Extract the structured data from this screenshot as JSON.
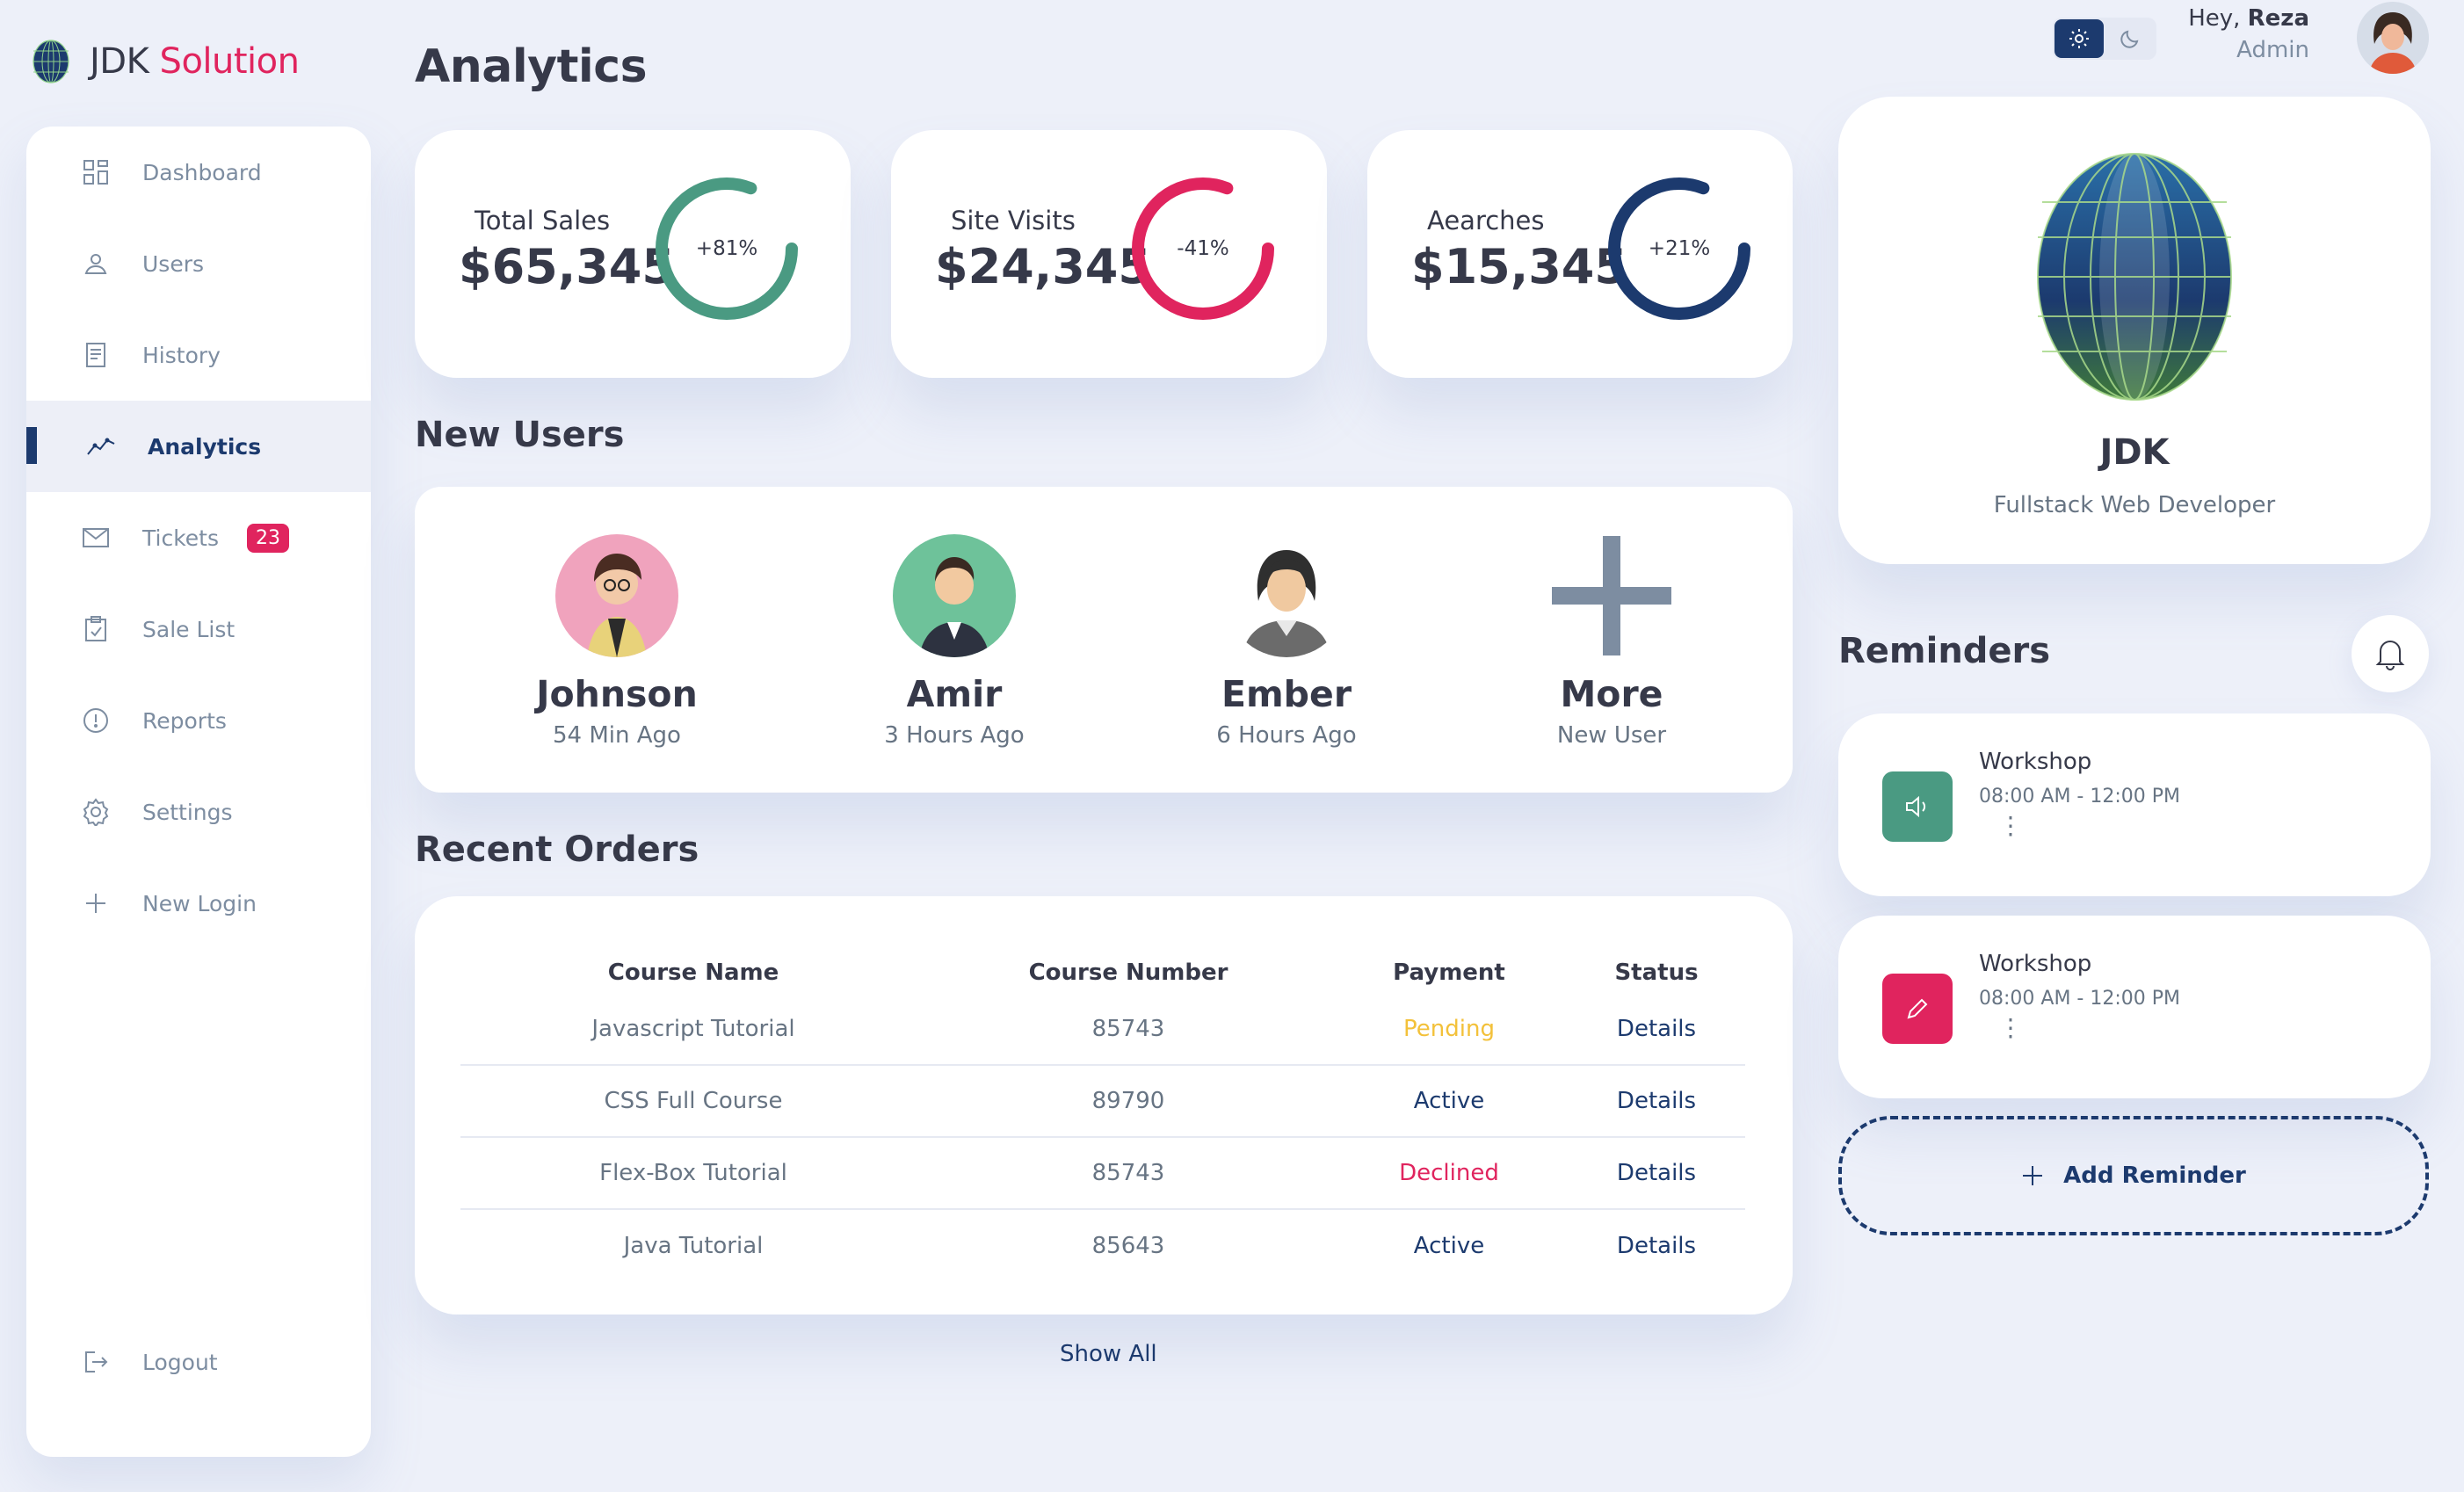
{
  "brand": {
    "name_part1": "JDK",
    "name_part2": "Solution"
  },
  "sidebar": {
    "items": [
      {
        "label": "Dashboard",
        "icon": "dashboard-icon"
      },
      {
        "label": "Users",
        "icon": "user-icon"
      },
      {
        "label": "History",
        "icon": "receipt-icon"
      },
      {
        "label": "Analytics",
        "icon": "analytics-icon",
        "active": true
      },
      {
        "label": "Tickets",
        "icon": "mail-icon",
        "badge": "23"
      },
      {
        "label": "Sale List",
        "icon": "clipboard-icon"
      },
      {
        "label": "Reports",
        "icon": "report-icon"
      },
      {
        "label": "Settings",
        "icon": "settings-icon"
      },
      {
        "label": "New Login",
        "icon": "plus-icon"
      }
    ],
    "logout": "Logout"
  },
  "page": {
    "title": "Analytics"
  },
  "stats": [
    {
      "label": "Total Sales",
      "value": "$65,345",
      "percent": "+81%",
      "fraction": 0.81,
      "color": "#4a9a82"
    },
    {
      "label": "Site Visits",
      "value": "$24,345",
      "percent": "-41%",
      "fraction": 0.81,
      "color": "#e0245e"
    },
    {
      "label": "Aearches",
      "value": "$15,345",
      "percent": "+21%",
      "fraction": 0.81,
      "color": "#1c3a6e"
    }
  ],
  "new_users": {
    "title": "New Users",
    "users": [
      {
        "name": "Johnson",
        "time": "54 Min Ago"
      },
      {
        "name": "Amir",
        "time": "3 Hours Ago"
      },
      {
        "name": "Ember",
        "time": "6 Hours Ago"
      },
      {
        "name": "More",
        "time": "New User"
      }
    ]
  },
  "orders": {
    "title": "Recent Orders",
    "headers": [
      "Course Name",
      "Course Number",
      "Payment",
      "Status"
    ],
    "rows": [
      {
        "name": "Javascript Tutorial",
        "number": "85743",
        "payment": "Pending",
        "status": "Details"
      },
      {
        "name": "CSS Full Course",
        "number": "89790",
        "payment": "Active",
        "status": "Details"
      },
      {
        "name": "Flex-Box Tutorial",
        "number": "85743",
        "payment": "Declined",
        "status": "Details"
      },
      {
        "name": "Java Tutorial",
        "number": "85643",
        "payment": "Active",
        "status": "Details"
      }
    ],
    "show_all": "Show All"
  },
  "header": {
    "greeting": "Hey,",
    "user": "Reza",
    "role": "Admin"
  },
  "profile": {
    "name": "JDK",
    "role": "Fullstack Web Developer"
  },
  "reminders": {
    "title": "Reminders",
    "items": [
      {
        "title": "Workshop",
        "time": "08:00 AM - 12:00 PM",
        "icon": "volume-icon",
        "color": "#4a9a82"
      },
      {
        "title": "Workshop",
        "time": "08:00 AM - 12:00 PM",
        "icon": "edit-icon",
        "color": "#e0245e"
      }
    ],
    "add_label": "Add Reminder"
  },
  "colors": {
    "primary": "#1c3a6e",
    "danger": "#e0245e",
    "success": "#4a9a82",
    "warning": "#f3c13a",
    "background": "#edf0f9"
  }
}
